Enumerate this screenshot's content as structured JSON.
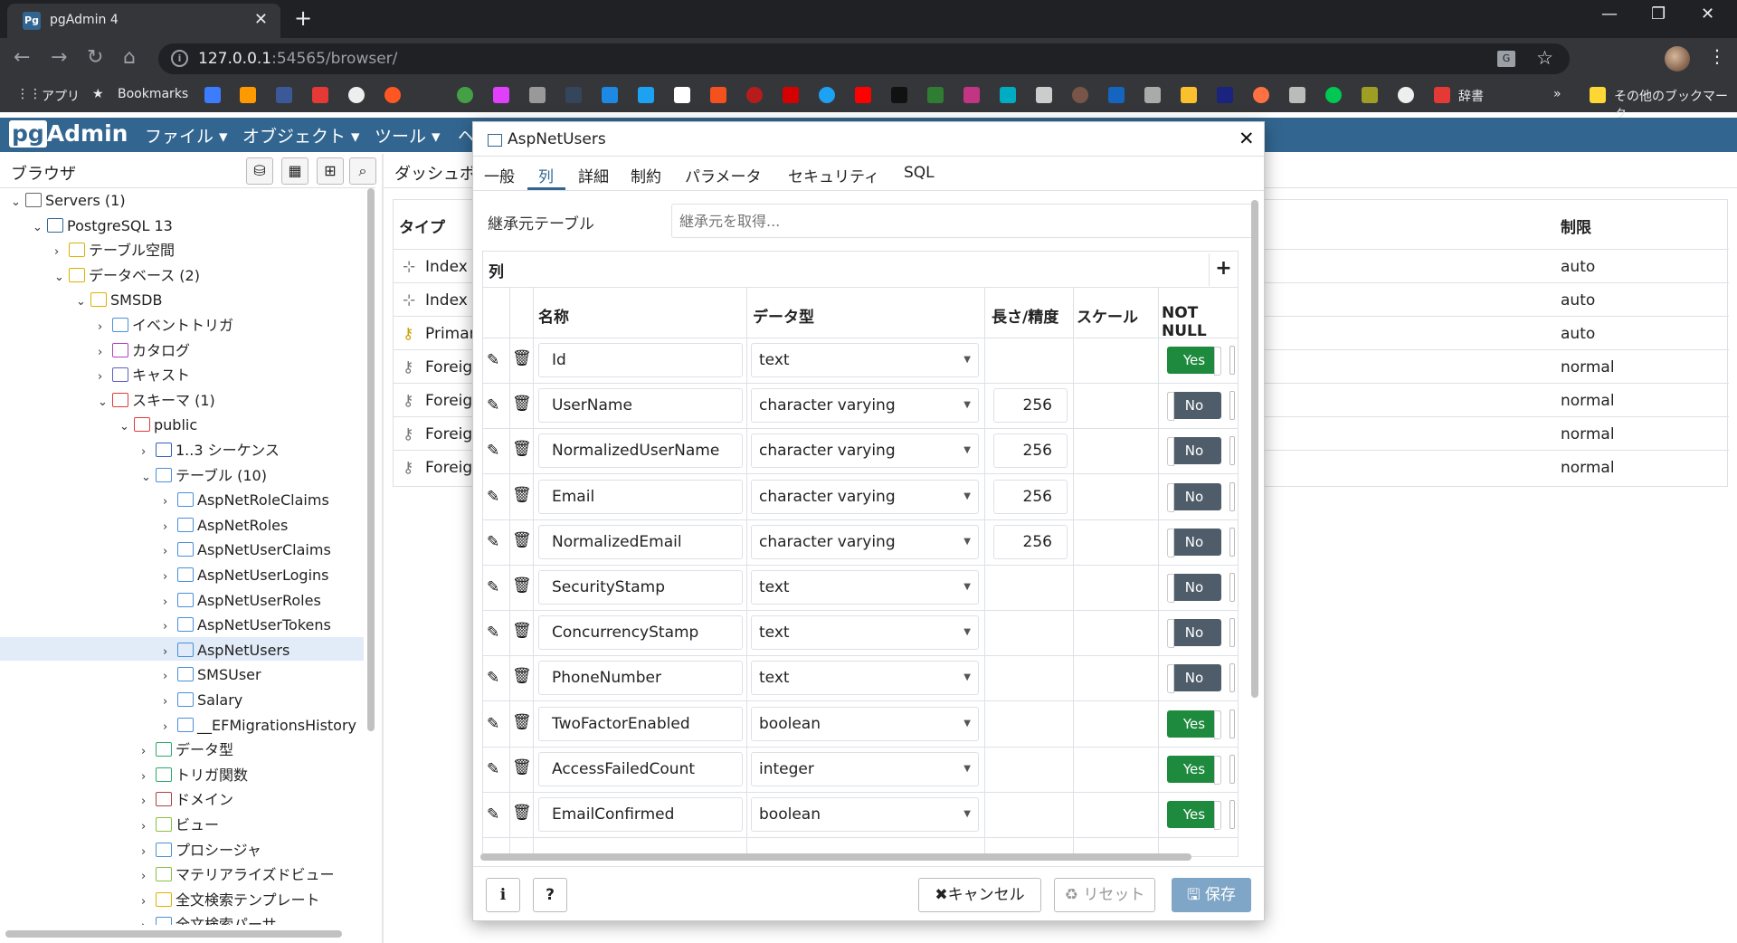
{
  "browser": {
    "tab_title": "pgAdmin 4",
    "url_host": "127.0.0.1",
    "url_rest": ":54565/browser/",
    "bookmarks": {
      "apps": "アプリ",
      "bookmarks": "Bookmarks",
      "jisho": "辞書",
      "other": "その他のブックマーク"
    }
  },
  "pgadmin": {
    "logo_a": "pg",
    "logo_b": "Admin",
    "menus": [
      "ファイル ▾",
      "オブジェクト ▾",
      "ツール ▾",
      "ヘ"
    ]
  },
  "browser_panel": {
    "title": "ブラウザ",
    "tree": [
      {
        "label": "Servers (1)"
      },
      {
        "label": "PostgreSQL 13"
      },
      {
        "label": "テーブル空間"
      },
      {
        "label": "データベース (2)"
      },
      {
        "label": "SMSDB"
      },
      {
        "label": "イベントトリガ"
      },
      {
        "label": "カタログ"
      },
      {
        "label": "キャスト"
      },
      {
        "label": "スキーマ (1)"
      },
      {
        "label": "public"
      },
      {
        "label": "1..3 シーケンス"
      },
      {
        "label": "テーブル (10)"
      },
      {
        "label": "AspNetRoleClaims"
      },
      {
        "label": "AspNetRoles"
      },
      {
        "label": "AspNetUserClaims"
      },
      {
        "label": "AspNetUserLogins"
      },
      {
        "label": "AspNetUserRoles"
      },
      {
        "label": "AspNetUserTokens"
      },
      {
        "label": "AspNetUsers"
      },
      {
        "label": "SMSUser"
      },
      {
        "label": "Salary"
      },
      {
        "label": "__EFMigrationsHistory"
      },
      {
        "label": "データ型"
      },
      {
        "label": "トリガ関数"
      },
      {
        "label": "ドメイン"
      },
      {
        "label": "ビュー"
      },
      {
        "label": "プロシージャ"
      },
      {
        "label": "マテリアライズドビュー"
      },
      {
        "label": "全文検索テンプレート"
      },
      {
        "label": "全文検索パーサ"
      }
    ]
  },
  "main_panel": {
    "tab": "ダッシュボ",
    "col_type": "タイプ",
    "col_limit": "制限",
    "rows": [
      {
        "type": "Index",
        "limit": "auto"
      },
      {
        "type": "Index",
        "limit": "auto"
      },
      {
        "type": "Primar",
        "limit": "auto"
      },
      {
        "type": "Foreign",
        "limit": "normal"
      },
      {
        "type": "Foreign",
        "limit": "normal"
      },
      {
        "type": "Foreign",
        "limit": "normal"
      },
      {
        "type": "Foreign",
        "limit": "normal"
      }
    ]
  },
  "dialog": {
    "title": "AspNetUsers",
    "tabs": [
      "一般",
      "列",
      "詳細",
      "制約",
      "パラメータ",
      "セキュリティ",
      "SQL"
    ],
    "inherit_label": "継承元テーブル",
    "inherit_placeholder": "継承元を取得...",
    "grid_title": "列",
    "headers": {
      "name": "名称",
      "type": "データ型",
      "length": "長さ/精度",
      "scale": "スケール",
      "notnull": "NOT NULL"
    },
    "columns": [
      {
        "name": "Id",
        "type": "text",
        "length": "",
        "notnull": "Yes"
      },
      {
        "name": "UserName",
        "type": "character varying",
        "length": "256",
        "notnull": "No"
      },
      {
        "name": "NormalizedUserName",
        "type": "character varying",
        "length": "256",
        "notnull": "No"
      },
      {
        "name": "Email",
        "type": "character varying",
        "length": "256",
        "notnull": "No"
      },
      {
        "name": "NormalizedEmail",
        "type": "character varying",
        "length": "256",
        "notnull": "No"
      },
      {
        "name": "SecurityStamp",
        "type": "text",
        "length": "",
        "notnull": "No"
      },
      {
        "name": "ConcurrencyStamp",
        "type": "text",
        "length": "",
        "notnull": "No"
      },
      {
        "name": "PhoneNumber",
        "type": "text",
        "length": "",
        "notnull": "No"
      },
      {
        "name": "TwoFactorEnabled",
        "type": "boolean",
        "length": "",
        "notnull": "Yes"
      },
      {
        "name": "AccessFailedCount",
        "type": "integer",
        "length": "",
        "notnull": "Yes"
      },
      {
        "name": "EmailConfirmed",
        "type": "boolean",
        "length": "",
        "notnull": "Yes"
      }
    ],
    "footer": {
      "info": "i",
      "help": "?",
      "cancel": "✖キャンセル",
      "reset": "♻ リセット",
      "save": "🖫 保存"
    }
  },
  "colors": {
    "brand": "#326690",
    "yes": "#1e8a3e",
    "no": "#4f5d6b",
    "selected": "#e1ecf8"
  }
}
